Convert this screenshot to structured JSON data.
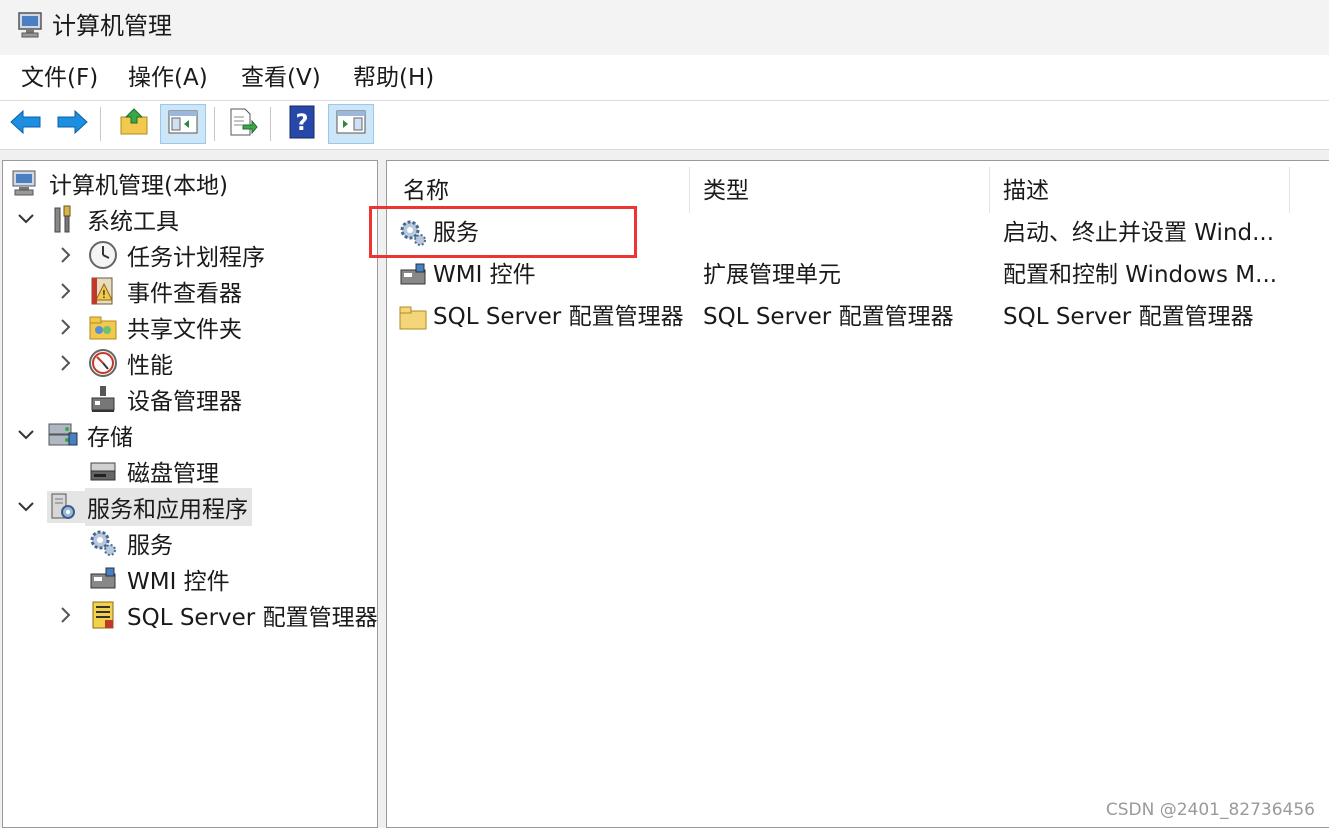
{
  "window": {
    "title": "计算机管理",
    "icon": "computer-management-icon"
  },
  "menubar": {
    "items": [
      "文件(F)",
      "操作(A)",
      "查看(V)",
      "帮助(H)"
    ]
  },
  "toolbar": {
    "buttons": [
      "back-arrow-icon",
      "forward-arrow-icon",
      "up-folder-icon",
      "show-hide-tree-icon",
      "export-list-icon",
      "help-icon",
      "action-pane-icon"
    ]
  },
  "tree": {
    "root": "计算机管理(本地)",
    "system_tools": "系统工具",
    "task_scheduler": "任务计划程序",
    "event_viewer": "事件查看器",
    "shared_folders": "共享文件夹",
    "performance": "性能",
    "device_manager": "设备管理器",
    "storage": "存储",
    "disk_management": "磁盘管理",
    "services_apps": "服务和应用程序",
    "services": "服务",
    "wmi": "WMI 控件",
    "sql_config": "SQL Server 配置管理器"
  },
  "list": {
    "columns": [
      "名称",
      "类型",
      "描述"
    ],
    "rows": [
      {
        "name": "服务",
        "type": "",
        "desc": "启动、终止并设置 Wind..."
      },
      {
        "name": "WMI 控件",
        "type": "扩展管理单元",
        "desc": "配置和控制 Windows M..."
      },
      {
        "name": "SQL Server 配置管理器",
        "type": "SQL Server 配置管理器",
        "desc": "SQL Server 配置管理器"
      }
    ]
  },
  "watermark": "CSDN @2401_82736456",
  "colors": {
    "highlight": "#ee3333",
    "selection": "#e5e5e5",
    "arrow": "#1e8fe0"
  }
}
